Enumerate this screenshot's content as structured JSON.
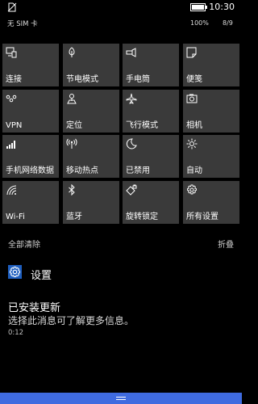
{
  "status_bar": {
    "time": "10:30",
    "carrier": "无 SIM 卡",
    "battery_percent": "100%",
    "notification_count": "8/9"
  },
  "quick_actions": [
    {
      "label": "连接",
      "icon": "connect-icon"
    },
    {
      "label": "节电模式",
      "icon": "battery-saver-icon"
    },
    {
      "label": "手电筒",
      "icon": "flashlight-icon"
    },
    {
      "label": "便笺",
      "icon": "note-icon"
    },
    {
      "label": "VPN",
      "icon": "vpn-icon"
    },
    {
      "label": "定位",
      "icon": "location-icon"
    },
    {
      "label": "飞行模式",
      "icon": "airplane-icon"
    },
    {
      "label": "相机",
      "icon": "camera-icon"
    },
    {
      "label": "手机网络数据",
      "icon": "cellular-icon"
    },
    {
      "label": "移动热点",
      "icon": "hotspot-icon"
    },
    {
      "label": "已禁用",
      "icon": "moon-icon"
    },
    {
      "label": "自动",
      "icon": "brightness-icon"
    },
    {
      "label": "Wi-Fi",
      "icon": "wifi-icon"
    },
    {
      "label": "蓝牙",
      "icon": "bluetooth-icon"
    },
    {
      "label": "旋转锁定",
      "icon": "rotation-lock-icon"
    },
    {
      "label": "所有设置",
      "icon": "settings-gear-icon"
    }
  ],
  "actions": {
    "clear_all": "全部清除",
    "collapse": "折叠"
  },
  "notification": {
    "app_name": "设置",
    "title": "已安装更新",
    "body": "选择此消息可了解更多信息。",
    "time": "0:12"
  },
  "colors": {
    "tile_bg": "#3a3a3a",
    "accent": "#3f6be0",
    "settings_icon_bg": "#1f5fbf"
  }
}
